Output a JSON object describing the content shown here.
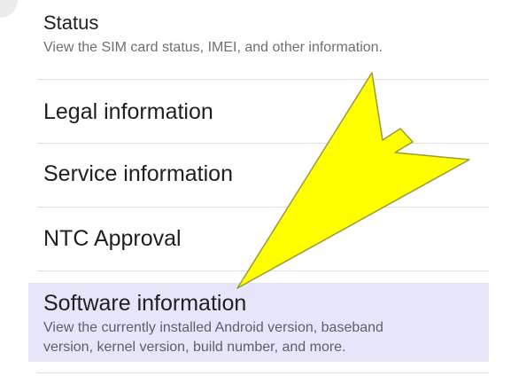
{
  "settings": {
    "items": [
      {
        "title": "Status",
        "subtitle": "View the SIM card status, IMEI, and other information."
      },
      {
        "title": "Legal information"
      },
      {
        "title": "Service information"
      },
      {
        "title": "NTC Approval"
      },
      {
        "title": "Software information",
        "subtitle_line1": "View the currently installed Android version, baseband",
        "subtitle_line2": "version, kernel version, build number, and more."
      }
    ]
  },
  "annotation": {
    "arrow_color": "#ffff00",
    "arrow_outline": "#9a9a3a",
    "highlight_color": "#e7e5f9",
    "icon": "pointer-arrow-icon"
  }
}
